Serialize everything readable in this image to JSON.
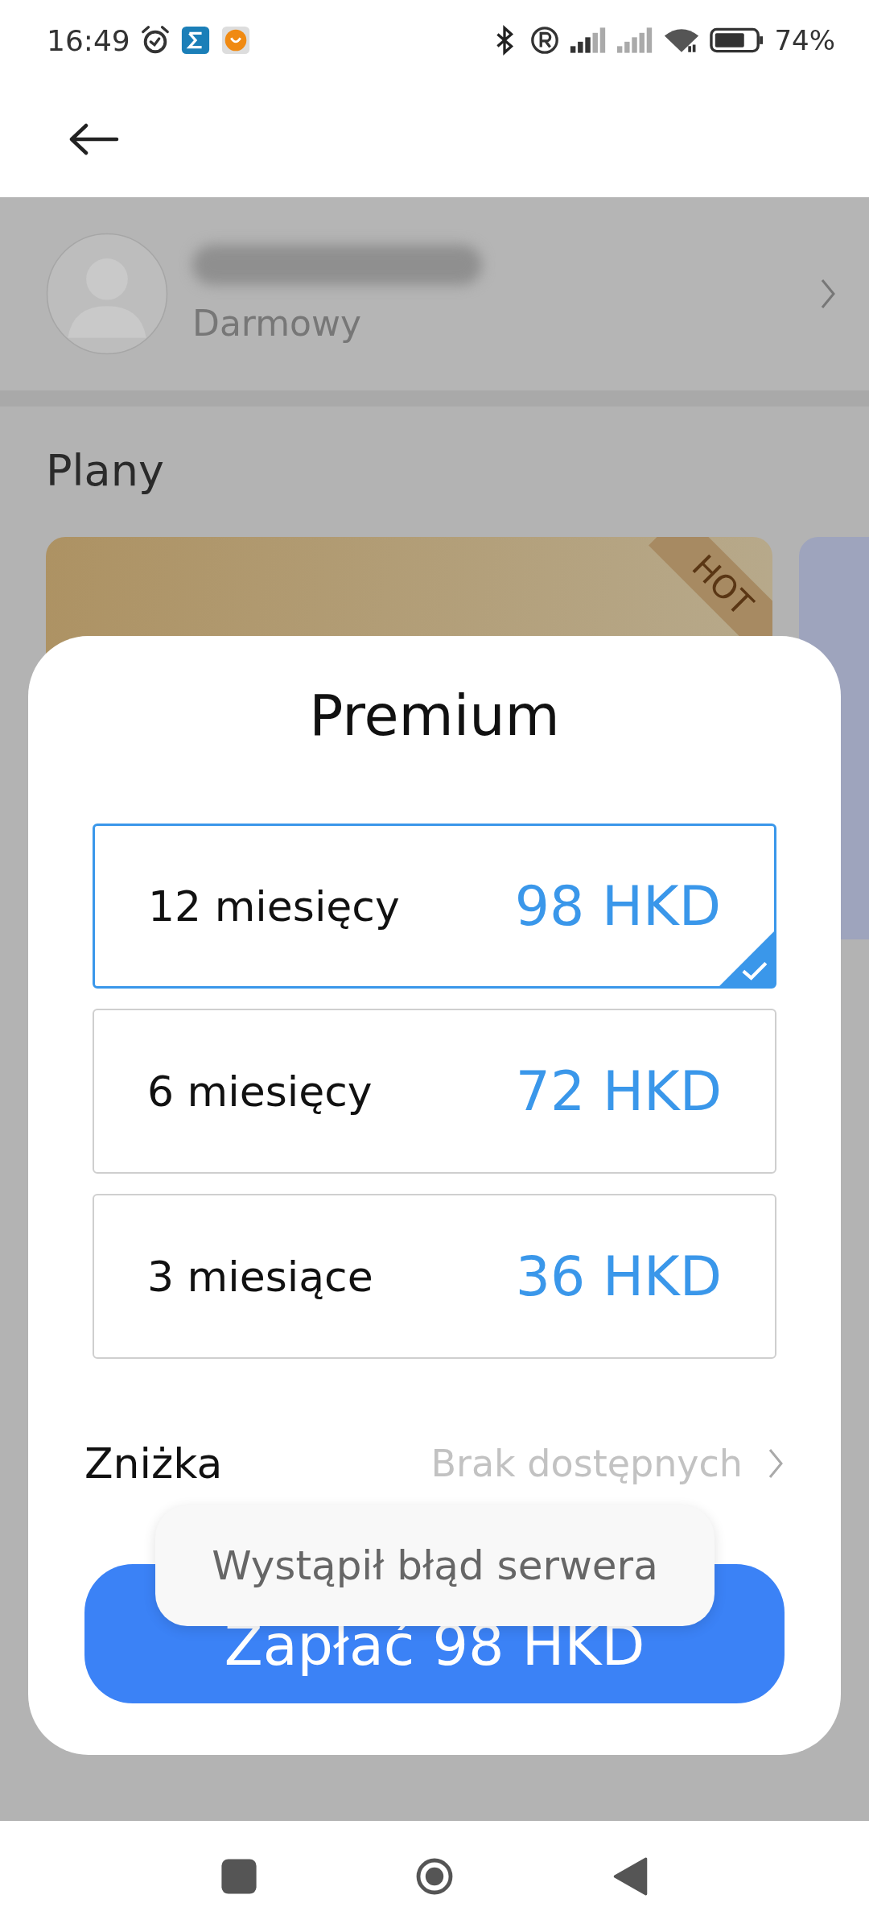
{
  "status_bar": {
    "time": "16:49",
    "battery": "74%"
  },
  "profile": {
    "plan": "Darmowy"
  },
  "plans": {
    "title": "Plany",
    "cards": [
      {
        "kind": "gold",
        "badge": "HOT"
      },
      {
        "kind": "blue"
      }
    ]
  },
  "sheet": {
    "title": "Premium",
    "options": [
      {
        "duration": "12 miesięcy",
        "price": "98 HKD",
        "selected": true
      },
      {
        "duration": "6 miesięcy",
        "price": "72 HKD",
        "selected": false
      },
      {
        "duration": "3 miesiące",
        "price": "36 HKD",
        "selected": false
      }
    ],
    "discount": {
      "label": "Zniżka",
      "value": "Brak dostępnych"
    },
    "pay_button": "Zapłać 98 HKD"
  },
  "toast": "Wystąpił błąd serwera"
}
